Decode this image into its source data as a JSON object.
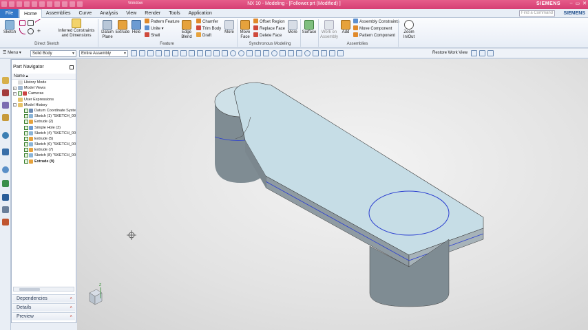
{
  "window": {
    "title": "NX 10 - Modeling - [Follower.prt (Modified) ]",
    "window_menu": "Window",
    "brand": "SIEMENS"
  },
  "menu": {
    "file": "File",
    "tabs": [
      "Home",
      "Assemblies",
      "Curve",
      "Analysis",
      "View",
      "Render",
      "Tools",
      "Application"
    ],
    "search_placeholder": "Find a Command",
    "brand": "SIEMENS"
  },
  "ribbon": {
    "sketch": "Sketch",
    "inferred_1": "Inferred Constraints",
    "inferred_2": "and Dimensions",
    "datum_1": "Datum",
    "datum_2": "Plane",
    "extrude": "Extrude",
    "hole": "Hole",
    "pattern_feature": "Pattern Feature",
    "unite": "Unite",
    "shell": "Shell",
    "edge_blend_1": "Edge",
    "edge_blend_2": "Blend",
    "chamfer": "Chamfer",
    "trim_body": "Trim Body",
    "draft": "Draft",
    "more_1": "More",
    "move_face_1": "Move",
    "move_face_2": "Face",
    "offset_region": "Offset Region",
    "replace_face": "Replace Face",
    "delete_face": "Delete Face",
    "more_2": "More",
    "surface": "Surface",
    "work_on_1": "Work on",
    "work_on_2": "Assembly",
    "add": "Add",
    "assembly_constraints": "Assembly Constraints",
    "move_component": "Move Component",
    "pattern_component": "Pattern Component",
    "zoom_1": "Zoom",
    "zoom_2": "In/Out",
    "groups": {
      "direct_sketch": "Direct Sketch",
      "feature": "Feature",
      "sync": "Synchronous Modeling",
      "assemblies": "Assemblies"
    }
  },
  "toolbar": {
    "menu": "Menu",
    "filter": "Solid Body",
    "scope": "Entire Assembly",
    "restore_view": "Restore Work View"
  },
  "navigator": {
    "title": "Part Navigator",
    "column": "Name",
    "items": [
      {
        "label": "History Mode"
      },
      {
        "label": "Model Views"
      },
      {
        "label": "Cameras"
      },
      {
        "label": "User Expressions"
      },
      {
        "label": "Model History"
      },
      {
        "label": "Datum Coordinate System"
      },
      {
        "label": "Sketch (1) \"SKETCH_000\""
      },
      {
        "label": "Extrude (2)"
      },
      {
        "label": "Simple Hole (3)"
      },
      {
        "label": "Sketch (4) \"SKETCH_002\""
      },
      {
        "label": "Extrude (5)"
      },
      {
        "label": "Sketch (6) \"SKETCH_003\""
      },
      {
        "label": "Extrude (7)"
      },
      {
        "label": "Sketch (8) \"SKETCH_004\""
      },
      {
        "label": "Extrude (9)"
      }
    ],
    "panels": {
      "dependencies": "Dependencies",
      "details": "Details",
      "preview": "Preview"
    }
  },
  "colors": {
    "title_bar": "#d63f74",
    "model_face": "#c6dde6",
    "model_side": "#7f8c93",
    "edge_highlight": "#2b3fd0"
  }
}
